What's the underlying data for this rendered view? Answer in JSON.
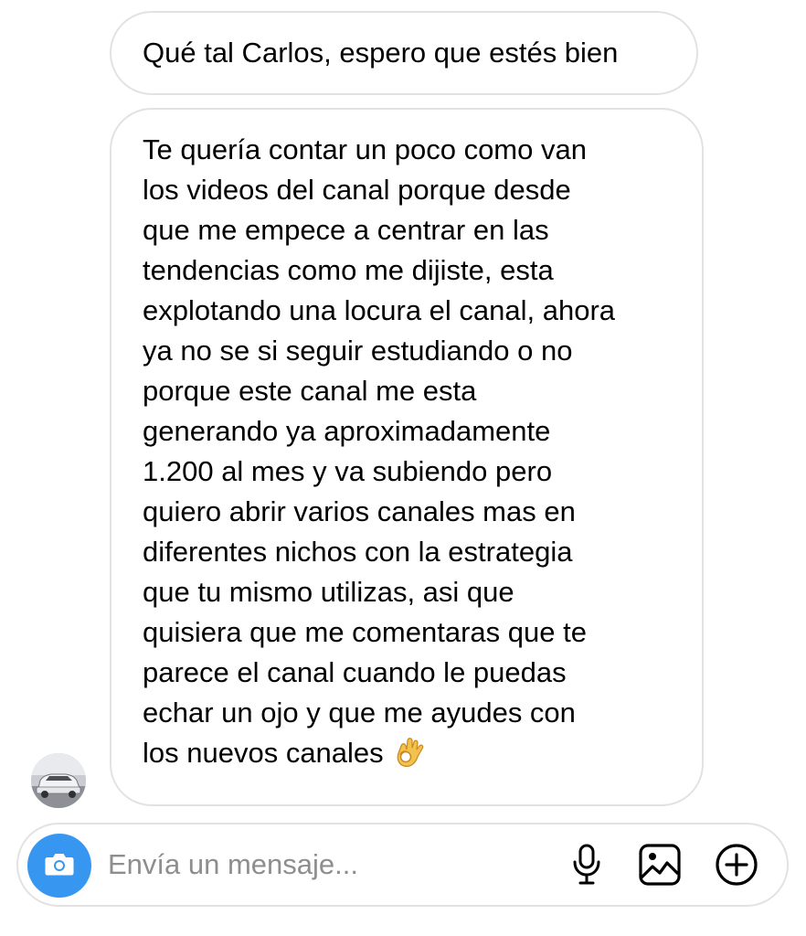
{
  "messages": [
    {
      "text": "Qué tal Carlos, espero que estés bien"
    },
    {
      "text": "Te quería contar un poco como van\nlos videos del canal porque desde\nque me empece a centrar en las\ntendencias como me dijiste, esta\nexplotando una locura el canal, ahora\nya no se si seguir estudiando o no\nporque este canal me esta\ngenerando ya aproximadamente\n1.200 al mes y va subiendo pero\nquiero abrir varios canales mas en\ndiferentes nichos con la estrategia\nque tu mismo utilizas, asi que\nquisiera que me comentaras que te\nparece el canal cuando le puedas\nechar un ojo y que me ayudes con\nlos nuevos canales",
      "emoji": "ok-hand-emoji"
    }
  ],
  "sender": {
    "avatar": "car-photo-avatar"
  },
  "composer": {
    "placeholder": "Envía un mensaje...",
    "camera_icon": "camera-icon",
    "mic_icon": "microphone-icon",
    "gallery_icon": "image-gallery-icon",
    "plus_icon": "plus-circle-icon",
    "accent_color": "#3797f0"
  },
  "colors": {
    "bubble_border": "#e2e2e2",
    "placeholder": "#8e8e8e",
    "text": "#000000"
  }
}
